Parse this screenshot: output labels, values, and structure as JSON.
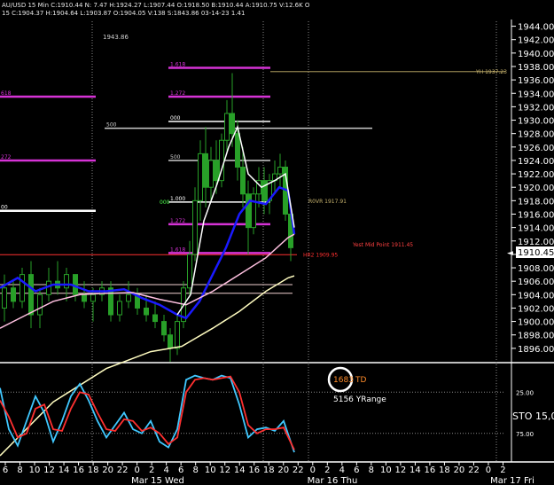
{
  "header": {
    "line1": "AU/USD  15 Min  C:1910.44  N:  7.47  H:1924.27  L:1907.44  O:1918.50  B:1910.44  A:1910.75  V:12.6K  O",
    "line2": "15  C:1904.37  H:1904.64  L:1903.87  O:1904.05  V:138  S:1843.86  03-14-23  1.41"
  },
  "chart_data": [
    {
      "type": "line",
      "title": "",
      "top_label": "1943.86",
      "y_ticks": [
        1896,
        1898,
        1900,
        1902,
        1904,
        1906,
        1908,
        1910,
        1912,
        1914,
        1916,
        1918,
        1920,
        1922,
        1924,
        1926,
        1928,
        1930,
        1932,
        1934,
        1936,
        1938,
        1940,
        1942,
        1944
      ],
      "y_tick_labels": [
        "1896.00",
        "1898.00",
        "1900.00",
        "1902.00",
        "1904.00",
        "1906.00",
        "1908.00",
        "1910.00",
        "1912.00",
        "1914.00",
        "1916.00",
        "1918.00",
        "1920.00",
        "1922.00",
        "1924.00",
        "1926.00",
        "1928.00",
        "1930.00",
        "1932.00",
        "1934.00",
        "1936.00",
        "1938.00",
        "1940.00",
        "1942.00",
        "1944.00"
      ],
      "ylim": [
        1894,
        1945
      ],
      "last_price_label": "1910.45",
      "levels": [
        {
          "label": "1.618",
          "value": 1937.8,
          "color": "#d633d6"
        },
        {
          "label": "1.272",
          "value": 1933.5,
          "color": "#d633d6"
        },
        {
          "label": "000",
          "value": 1929.8,
          "color": "#ffffff"
        },
        {
          "label": "500",
          "value": 1928.8,
          "color": "#cccccc"
        },
        {
          "label": "500",
          "value": 1924.0,
          "color": "#cccccc"
        },
        {
          "label": "1.000",
          "value": 1917.8,
          "color": "#ffffff"
        },
        {
          "label": "1.272",
          "value": 1914.5,
          "color": "#d633d6"
        },
        {
          "label": "1.618",
          "value": 1910.2,
          "color": "#d633d6"
        }
      ],
      "left_levels": [
        {
          "label": "618",
          "value": 1933.5,
          "color": "#d633d6"
        },
        {
          "label": "272",
          "value": 1924.0,
          "color": "#d633d6"
        },
        {
          "label": "00",
          "value": 1916.5,
          "color": "#ffffff"
        }
      ],
      "annotations": [
        {
          "text": "YH 1937.23",
          "value": 1937.23,
          "color": "#c8b46e"
        },
        {
          "text": "R0VR 1917.91",
          "value": 1917.91,
          "color": "#c8b46e"
        },
        {
          "text": "Yest Mid Point 1911.45",
          "value": 1911.45,
          "color": "#ff4040"
        },
        {
          "text": "HR2 1909.95",
          "value": 1909.95,
          "color": "#ff3030"
        },
        {
          "text": "000",
          "value": 1917.8,
          "color": "#4cff4c"
        }
      ],
      "series": [
        {
          "name": "",
          "color": "#1a1aff",
          "points": [
            [
              0,
              1905
            ],
            [
              20,
              1906.5
            ],
            [
              40,
              1904.5
            ],
            [
              60,
              1905.5
            ],
            [
              80,
              1905.5
            ],
            [
              100,
              1904.5
            ],
            [
              120,
              1904.5
            ],
            [
              140,
              1904.8
            ],
            [
              160,
              1903.5
            ],
            [
              180,
              1902.5
            ],
            [
              200,
              1901.0
            ],
            [
              210,
              1900.5
            ],
            [
              225,
              1903.0
            ],
            [
              240,
              1907.0
            ],
            [
              255,
              1911.0
            ],
            [
              270,
              1916.0
            ],
            [
              282,
              1918.0
            ],
            [
              300,
              1917.5
            ],
            [
              315,
              1920.0
            ],
            [
              325,
              1919.5
            ],
            [
              332,
              1913.0
            ]
          ]
        },
        {
          "name": "",
          "color": "#ffc0e0",
          "points": [
            [
              0,
              1899
            ],
            [
              30,
              1901
            ],
            [
              60,
              1903
            ],
            [
              90,
              1904
            ],
            [
              120,
              1904.2
            ],
            [
              150,
              1904.3
            ],
            [
              180,
              1903.3
            ],
            [
              210,
              1902.5
            ],
            [
              240,
              1904.5
            ],
            [
              270,
              1907
            ],
            [
              300,
              1909.5
            ],
            [
              325,
              1912.5
            ],
            [
              332,
              1913
            ]
          ]
        },
        {
          "name": "",
          "color": "#fffcc0",
          "points": [
            [
              0,
              1880
            ],
            [
              60,
              1888
            ],
            [
              120,
              1893
            ],
            [
              170,
              1895.5
            ],
            [
              205,
              1896.3
            ],
            [
              240,
              1899
            ],
            [
              270,
              1901.5
            ],
            [
              300,
              1904.5
            ],
            [
              325,
              1906.5
            ],
            [
              332,
              1906.8
            ]
          ]
        },
        {
          "name": "",
          "color": "#ffffff",
          "points": [
            [
              200,
              1901
            ],
            [
              215,
              1904
            ],
            [
              230,
              1915
            ],
            [
              245,
              1920.5
            ],
            [
              258,
              1926
            ],
            [
              268,
              1929
            ],
            [
              280,
              1922
            ],
            [
              295,
              1920
            ],
            [
              310,
              1921
            ],
            [
              322,
              1922
            ],
            [
              332,
              1914
            ]
          ]
        }
      ],
      "candles": [
        [
          5,
          1902,
          1907,
          1900,
          1905
        ],
        [
          15,
          1905,
          1906,
          1902,
          1903
        ],
        [
          25,
          1903,
          1908,
          1902,
          1907
        ],
        [
          35,
          1907,
          1909,
          1899,
          1901
        ],
        [
          45,
          1901,
          1905,
          1899,
          1904
        ],
        [
          55,
          1904,
          1908,
          1903,
          1906
        ],
        [
          65,
          1906,
          1909,
          1904,
          1905
        ],
        [
          75,
          1905,
          1908,
          1903,
          1907
        ],
        [
          85,
          1907,
          1907,
          1903,
          1904
        ],
        [
          95,
          1904,
          1906,
          1902,
          1903
        ],
        [
          105,
          1903,
          1905,
          1900,
          1904
        ],
        [
          115,
          1904,
          1906,
          1903,
          1905
        ],
        [
          125,
          1905,
          1906,
          1900,
          1901
        ],
        [
          135,
          1901,
          1904,
          1900,
          1903
        ],
        [
          145,
          1903,
          1906,
          1902,
          1904
        ],
        [
          155,
          1904,
          1905,
          1901,
          1902
        ],
        [
          165,
          1902,
          1904,
          1900,
          1901
        ],
        [
          175,
          1901,
          1903,
          1899,
          1900
        ],
        [
          185,
          1900,
          1901,
          1897,
          1898
        ],
        [
          192,
          1898,
          1899,
          1894,
          1896
        ],
        [
          200,
          1896,
          1901,
          1895,
          1900
        ],
        [
          207,
          1900,
          1906,
          1899,
          1905
        ],
        [
          214,
          1905,
          1912,
          1904,
          1910
        ],
        [
          220,
          1910,
          1920,
          1909,
          1918
        ],
        [
          226,
          1918,
          1927,
          1915,
          1925
        ],
        [
          232,
          1925,
          1929,
          1917,
          1920
        ],
        [
          238,
          1920,
          1926,
          1918,
          1924
        ],
        [
          244,
          1924,
          1927,
          1919,
          1921
        ],
        [
          250,
          1921,
          1928,
          1920,
          1927
        ],
        [
          256,
          1927,
          1933,
          1925,
          1931
        ],
        [
          262,
          1931,
          1937,
          1926,
          1928
        ],
        [
          268,
          1928,
          1930,
          1921,
          1923
        ],
        [
          274,
          1923,
          1926,
          1917,
          1919
        ],
        [
          280,
          1919,
          1921,
          1910,
          1914
        ],
        [
          286,
          1914,
          1920,
          1913,
          1919
        ],
        [
          292,
          1919,
          1923,
          1917,
          1921
        ],
        [
          298,
          1921,
          1923,
          1916,
          1918
        ],
        [
          304,
          1918,
          1922,
          1916,
          1921
        ],
        [
          310,
          1921,
          1924,
          1919,
          1922
        ],
        [
          316,
          1922,
          1925,
          1920,
          1923
        ],
        [
          322,
          1923,
          1924,
          1915,
          1916
        ],
        [
          328,
          1916,
          1917,
          1909,
          1911
        ]
      ]
    },
    {
      "type": "line",
      "title": "",
      "indicator_label": "STO",
      "indicator_value": "15,0",
      "y_tick_labels": [
        "25.00",
        "75.00"
      ],
      "circle_value": "1683",
      "circle_suffix": "TD",
      "range_text": "5156 YRange",
      "ylim": [
        0,
        100
      ],
      "series": [
        {
          "name": "",
          "color": "#40c8ff",
          "points": [
            [
              0,
              20
            ],
            [
              10,
              70
            ],
            [
              20,
              90
            ],
            [
              30,
              60
            ],
            [
              40,
              30
            ],
            [
              50,
              50
            ],
            [
              60,
              85
            ],
            [
              70,
              60
            ],
            [
              80,
              30
            ],
            [
              90,
              15
            ],
            [
              100,
              35
            ],
            [
              110,
              60
            ],
            [
              120,
              80
            ],
            [
              130,
              65
            ],
            [
              140,
              50
            ],
            [
              150,
              70
            ],
            [
              160,
              75
            ],
            [
              170,
              60
            ],
            [
              180,
              85
            ],
            [
              190,
              92
            ],
            [
              200,
              70
            ],
            [
              210,
              10
            ],
            [
              220,
              5
            ],
            [
              230,
              8
            ],
            [
              240,
              10
            ],
            [
              250,
              5
            ],
            [
              260,
              8
            ],
            [
              270,
              40
            ],
            [
              280,
              80
            ],
            [
              290,
              70
            ],
            [
              300,
              68
            ],
            [
              310,
              72
            ],
            [
              320,
              60
            ],
            [
              332,
              98
            ]
          ]
        },
        {
          "name": "",
          "color": "#ff3030",
          "points": [
            [
              0,
              35
            ],
            [
              10,
              55
            ],
            [
              20,
              80
            ],
            [
              30,
              75
            ],
            [
              40,
              45
            ],
            [
              50,
              40
            ],
            [
              60,
              70
            ],
            [
              70,
              72
            ],
            [
              80,
              45
            ],
            [
              90,
              25
            ],
            [
              100,
              28
            ],
            [
              110,
              50
            ],
            [
              120,
              70
            ],
            [
              130,
              72
            ],
            [
              140,
              58
            ],
            [
              150,
              60
            ],
            [
              160,
              72
            ],
            [
              170,
              68
            ],
            [
              180,
              75
            ],
            [
              190,
              88
            ],
            [
              200,
              80
            ],
            [
              210,
              25
            ],
            [
              220,
              10
            ],
            [
              230,
              8
            ],
            [
              240,
              10
            ],
            [
              250,
              8
            ],
            [
              260,
              6
            ],
            [
              270,
              25
            ],
            [
              280,
              65
            ],
            [
              290,
              75
            ],
            [
              300,
              70
            ],
            [
              310,
              70
            ],
            [
              320,
              68
            ],
            [
              332,
              95
            ]
          ]
        }
      ]
    }
  ],
  "time_axis": {
    "ticks": [
      "6",
      "8",
      "10",
      "12",
      "14",
      "16",
      "18",
      "20",
      "22",
      "0",
      "2",
      "4",
      "6",
      "8",
      "10",
      "12",
      "14",
      "16",
      "18",
      "20",
      "22",
      "0",
      "2",
      "4",
      "6",
      "8",
      "10",
      "12",
      "14",
      "16",
      "18",
      "20",
      "22",
      "0",
      "2"
    ],
    "days": [
      "Mar 15 Wed",
      "Mar 16 Thu",
      "Mar 17 Fri"
    ]
  }
}
